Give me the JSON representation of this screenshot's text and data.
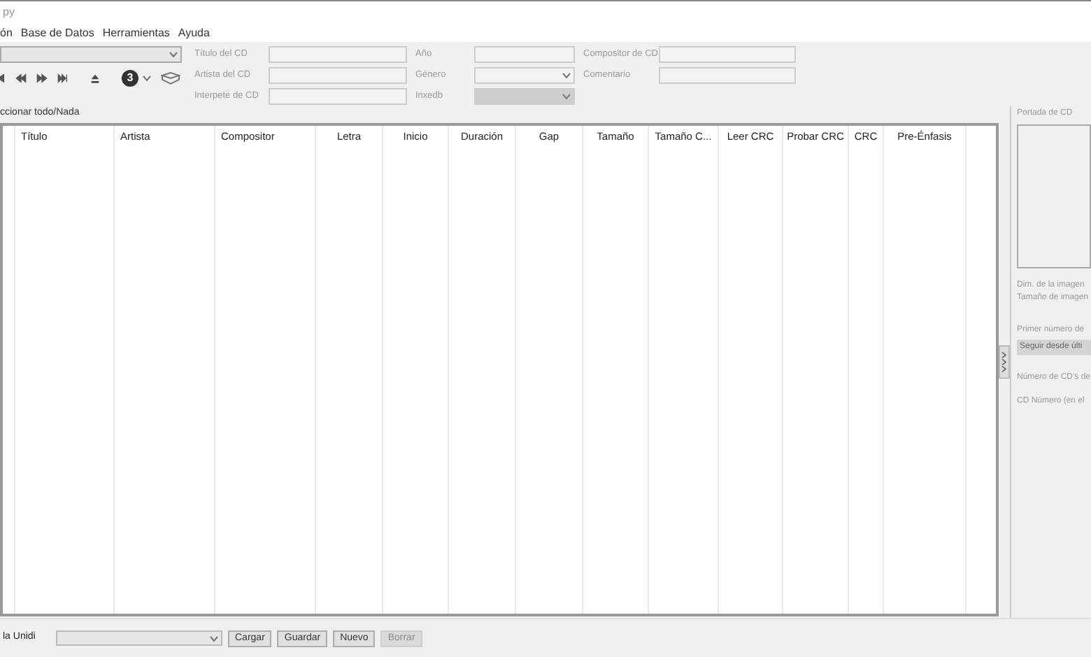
{
  "window": {
    "title": "py"
  },
  "menu": [
    {
      "label": "ón"
    },
    {
      "label": "Base de Datos"
    },
    {
      "label": "Herramientas"
    },
    {
      "label": "Ayuda"
    }
  ],
  "toolbar": {
    "track_number": "3"
  },
  "cd_fields": [
    {
      "label": "Título del CD",
      "kind": "text",
      "disabled": false
    },
    {
      "label": "Artista del CD",
      "kind": "text",
      "disabled": false
    },
    {
      "label": "Interpete de CD",
      "kind": "text",
      "disabled": false
    },
    {
      "label": "Año",
      "kind": "text",
      "disabled": false
    },
    {
      "label": "Género",
      "kind": "select",
      "disabled": false
    },
    {
      "label": "Inxedb",
      "kind": "select",
      "disabled": true
    },
    {
      "label": "Compositor de CD",
      "kind": "text",
      "disabled": false
    },
    {
      "label": "Comentario",
      "kind": "text",
      "disabled": false
    }
  ],
  "select_all_link": "ccionar todo/Nada",
  "table": {
    "columns": [
      "Título",
      "Artista",
      "Compositor",
      "Letra",
      "Inicio",
      "Duración",
      "Gap",
      "Tamaño",
      "Tamaño C...",
      "Leer CRC",
      "Probar CRC",
      "CRC",
      "Pre-Énfasis"
    ]
  },
  "side_panel": {
    "cover_label": "Portada de CD",
    "image_dims": "Dim. de la imagen",
    "image_size": "Tamaño de imagen",
    "first_number_label": "Primer número de",
    "first_number_value": "Seguir desde últi",
    "cd_count": "Número de CD's de",
    "cd_number": "CD Número (en el"
  },
  "bottom_bar": {
    "drive_label": "la Unidi",
    "buttons": [
      {
        "label": "Cargar",
        "disabled": false
      },
      {
        "label": "Guardar",
        "disabled": false
      },
      {
        "label": "Nuevo",
        "disabled": false
      },
      {
        "label": "Borrar",
        "disabled": true
      }
    ]
  }
}
